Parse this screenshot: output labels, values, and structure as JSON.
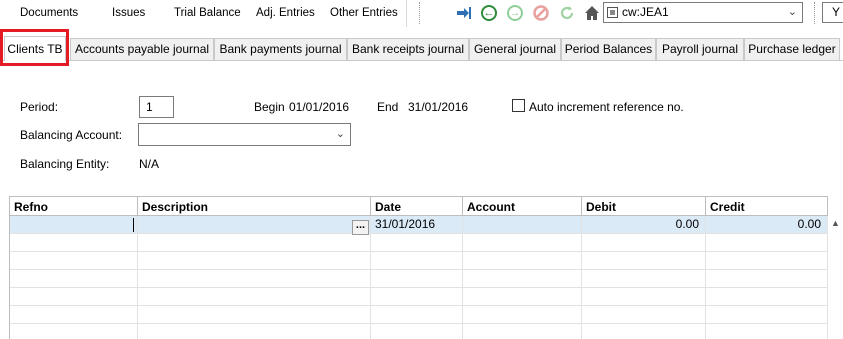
{
  "top_menu": {
    "items": [
      "Documents",
      "Issues",
      "Trial Balance",
      "Adj. Entries",
      "Other Entries"
    ]
  },
  "toolbar": {
    "icons": [
      "import-arrow-icon",
      "back-icon",
      "forward-icon",
      "stop-icon",
      "refresh-icon",
      "home-icon"
    ],
    "location_value": "cw:JEA1",
    "extra_value": "Y"
  },
  "journal_tabs": {
    "items": [
      "Clients TB",
      "Accounts payable journal",
      "Bank payments journal",
      "Bank receipts journal",
      "General journal",
      "Period Balances",
      "Payroll journal",
      "Purchase ledger"
    ],
    "active": "Clients TB"
  },
  "form": {
    "period_label": "Period:",
    "period_value": "1",
    "begin_label": "Begin",
    "begin_value": "01/01/2016",
    "end_label": "End",
    "end_value": "31/01/2016",
    "auto_increment_label": "Auto increment reference no.",
    "balancing_account_label": "Balancing Account:",
    "balancing_account_value": "",
    "balancing_entity_label": "Balancing Entity:",
    "balancing_entity_value": "N/A"
  },
  "grid": {
    "columns": [
      "Refno",
      "Description",
      "Date",
      "Account",
      "Debit",
      "Credit"
    ],
    "rows": [
      {
        "refno": "",
        "description": "",
        "date": "31/01/2016",
        "account": "",
        "debit": "0.00",
        "credit": "0.00"
      }
    ],
    "ellipsis": "..."
  },
  "colors": {
    "highlight": "#e21b24",
    "selected_row": "#dbeaf7",
    "nav_green": "#2e8b3a",
    "stop_red": "#d9534f",
    "import_blue": "#2f6fb3"
  }
}
